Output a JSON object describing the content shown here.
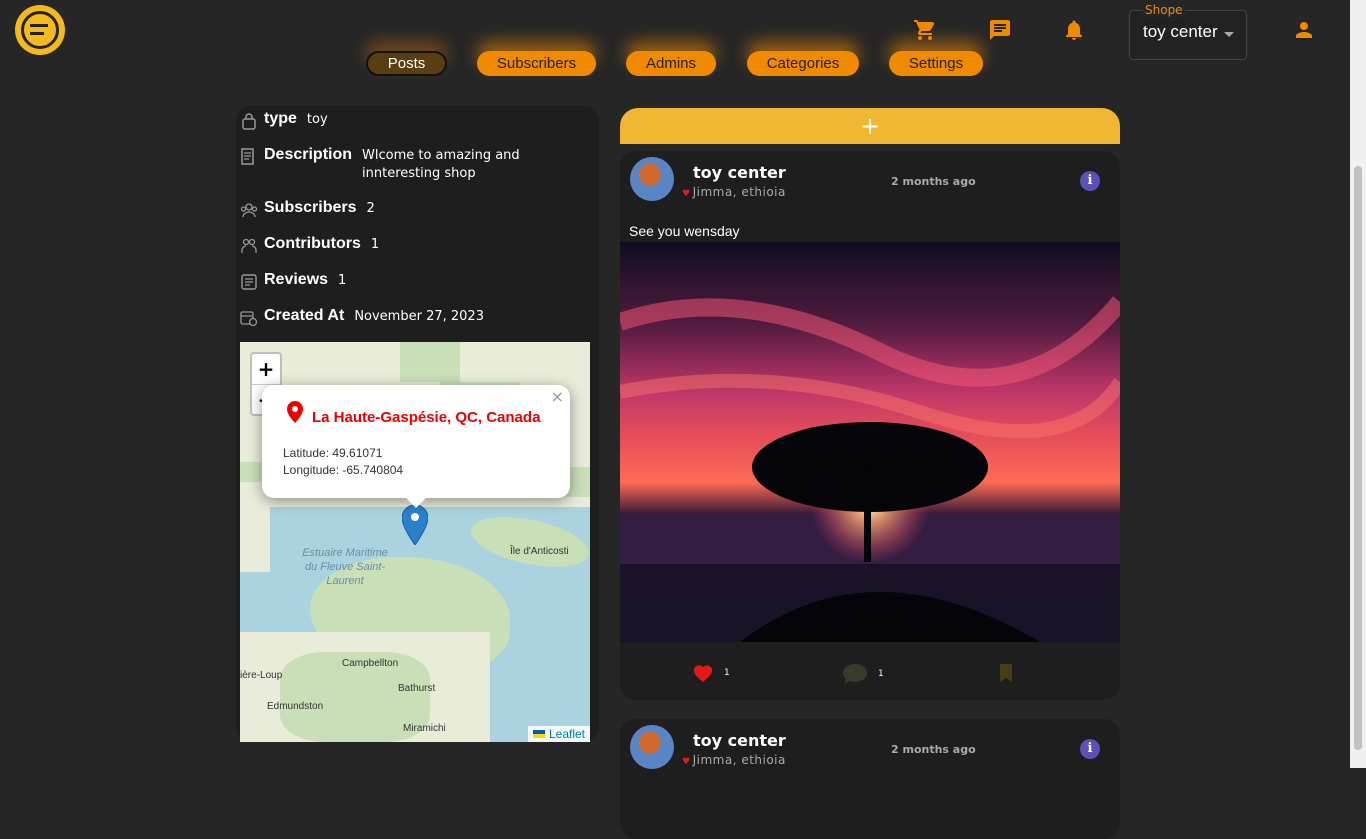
{
  "header": {
    "shop_select_label": "Shope",
    "shop_select_value": "toy center",
    "icons": [
      "cart-icon",
      "chat-icon",
      "bell-icon",
      "user-icon"
    ],
    "accent_color": "#f08a00"
  },
  "tabs": [
    {
      "label": "Posts",
      "active": true
    },
    {
      "label": "Subscribers"
    },
    {
      "label": "Admins"
    },
    {
      "label": "Categories"
    },
    {
      "label": "Settings"
    }
  ],
  "info": {
    "type_label": "type",
    "type_value": "toy",
    "description_label": "Description",
    "description_value": "Wlcome to amazing and innteresting shop",
    "subscribers_label": "Subscribers",
    "subscribers_value": "2",
    "contributors_label": "Contributors",
    "contributors_value": "1",
    "reviews_label": "Reviews",
    "reviews_value": "1",
    "created_label": "Created At",
    "created_value": "November 27, 2023"
  },
  "map": {
    "zoom_in": "+",
    "zoom_out": "−",
    "popup_title": "La Haute-Gaspésie, QC, Canada",
    "latitude": "Latitude: 49.61071",
    "longitude": "Longitude: -65.740804",
    "close": "×",
    "labels": {
      "anticosti": "Île d'Anticosti",
      "estuaire": "Estuaire Maritime du Fleuve Saint-Laurent",
      "campbellton": "Campbellton",
      "bathurst": "Bathurst",
      "edmundston": "Edmundston",
      "miramichi": "Miramichi",
      "loup": "ière-Loup"
    },
    "attribution": "Leaflet"
  },
  "add_post": "+",
  "posts": [
    {
      "name": "toy center",
      "location": "Jimma, ethioia",
      "time": "2 months ago",
      "text": "See you wensday",
      "likes": "1",
      "comments": "1"
    },
    {
      "name": "toy center",
      "location": "Jimma, ethioia",
      "time": "2 months ago"
    }
  ]
}
